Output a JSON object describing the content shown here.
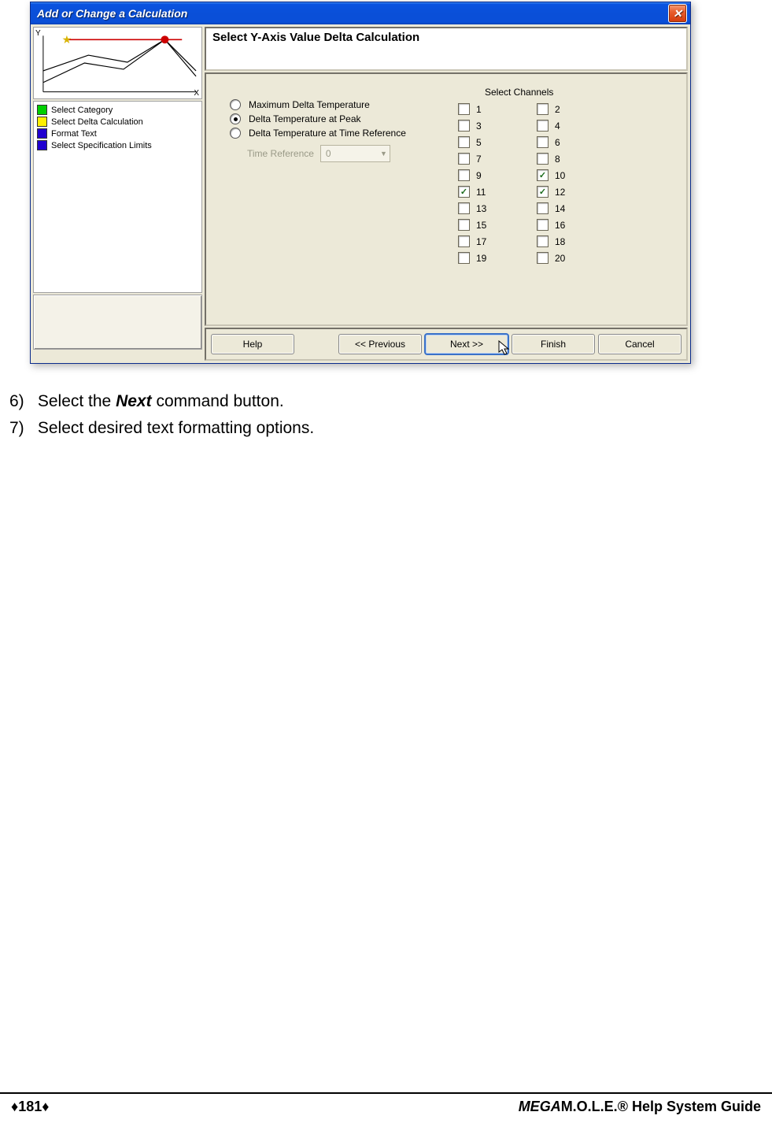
{
  "dialog": {
    "title": "Add or Change a Calculation",
    "axis_y": "Y",
    "axis_x": "X",
    "legend": [
      {
        "color": "leg-green",
        "label": "Select Category"
      },
      {
        "color": "leg-yellow",
        "label": "Select Delta Calculation"
      },
      {
        "color": "leg-blue",
        "label": "Format Text"
      },
      {
        "color": "leg-blue",
        "label": "Select Specification Limits"
      }
    ],
    "header": "Select Y-Axis Value Delta Calculation",
    "radios": {
      "r1": "Maximum Delta Temperature",
      "r2": "Delta Temperature at Peak",
      "r3": "Delta Temperature at Time Reference"
    },
    "selected_radio": "r2",
    "time_ref_label": "Time Reference",
    "time_ref_value": "0",
    "channels_head": "Select Channels",
    "channels": [
      {
        "n": "1",
        "c": false
      },
      {
        "n": "2",
        "c": false
      },
      {
        "n": "3",
        "c": false
      },
      {
        "n": "4",
        "c": false
      },
      {
        "n": "5",
        "c": false
      },
      {
        "n": "6",
        "c": false
      },
      {
        "n": "7",
        "c": false
      },
      {
        "n": "8",
        "c": false
      },
      {
        "n": "9",
        "c": false
      },
      {
        "n": "10",
        "c": true
      },
      {
        "n": "11",
        "c": true
      },
      {
        "n": "12",
        "c": true
      },
      {
        "n": "13",
        "c": false
      },
      {
        "n": "14",
        "c": false
      },
      {
        "n": "15",
        "c": false
      },
      {
        "n": "16",
        "c": false
      },
      {
        "n": "17",
        "c": false
      },
      {
        "n": "18",
        "c": false
      },
      {
        "n": "19",
        "c": false
      },
      {
        "n": "20",
        "c": false
      }
    ],
    "buttons": {
      "help": "Help",
      "prev": "<< Previous",
      "next": "Next >>",
      "finish": "Finish",
      "cancel": "Cancel"
    }
  },
  "instructions": {
    "i6_num": "6)",
    "i6_a": "Select the ",
    "i6_b": "Next",
    "i6_c": " command button.",
    "i7_num": "7)",
    "i7_a": "Select desired text formatting options."
  },
  "footer": {
    "page": "181",
    "brand_em": "MEGA",
    "brand_rest": "M.O.L.E.® Help System Guide"
  }
}
